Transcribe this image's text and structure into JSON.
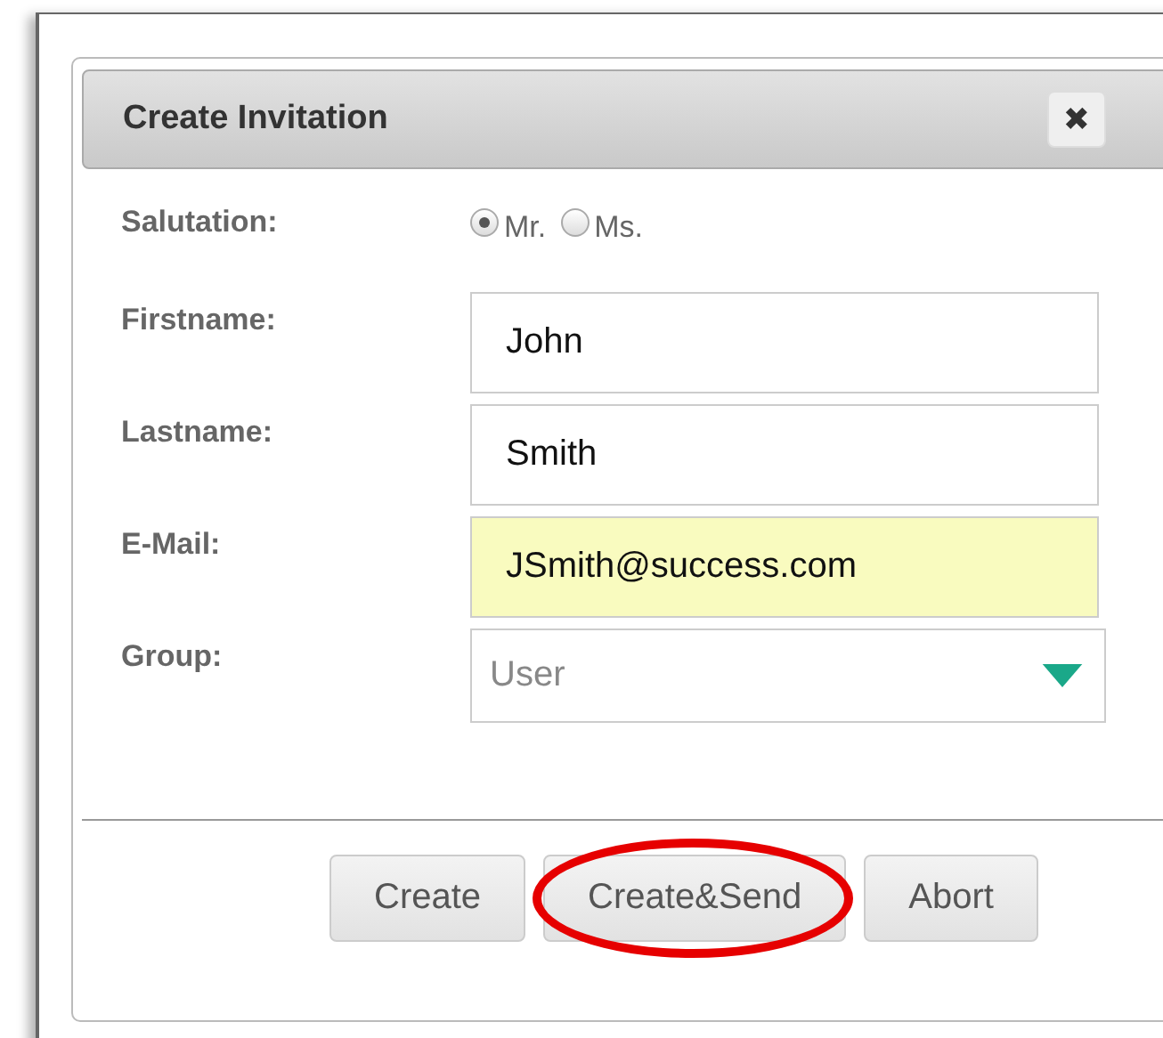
{
  "dialog": {
    "title": "Create Invitation",
    "close": "✖"
  },
  "salutation": {
    "label": "Salutation:",
    "options": [
      {
        "label": "Mr.",
        "selected": true
      },
      {
        "label": "Ms.",
        "selected": false
      }
    ]
  },
  "fields": [
    {
      "kind": "text",
      "label": "Firstname:",
      "value": "John",
      "highlighted": false
    },
    {
      "kind": "text",
      "label": "Lastname:",
      "value": "Smith",
      "highlighted": false
    },
    {
      "kind": "text",
      "label": "E-Mail:",
      "value": "JSmith@success.com",
      "highlighted": true
    },
    {
      "kind": "select",
      "label": "Group:",
      "value": "User",
      "highlighted": false
    }
  ],
  "buttons": [
    {
      "label": "Create",
      "circled": false
    },
    {
      "label": "Create&Send",
      "circled": true
    },
    {
      "label": "Abort",
      "circled": false
    }
  ]
}
